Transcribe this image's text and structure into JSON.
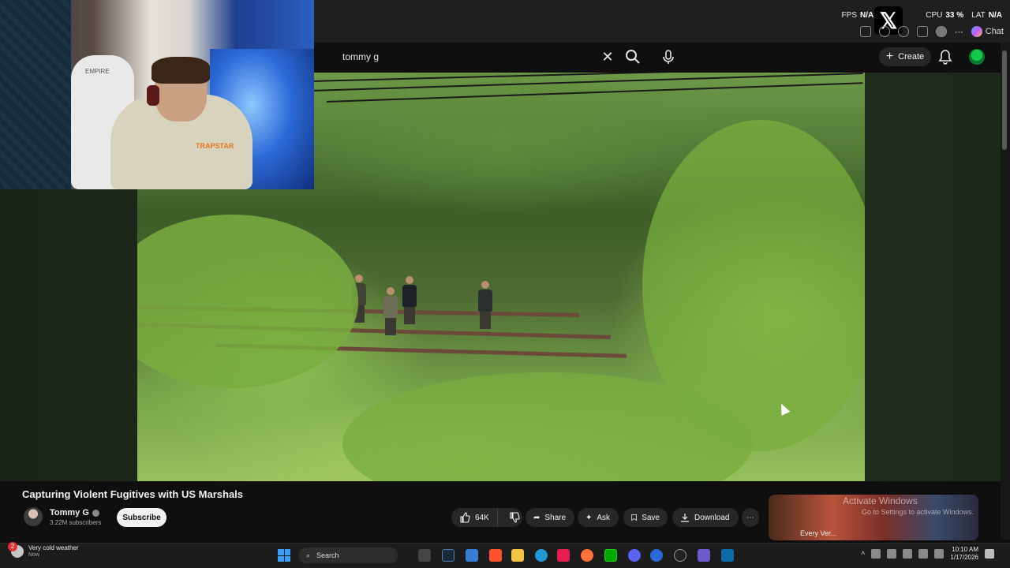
{
  "overlay": {
    "fps_label": "FPS",
    "fps_value": "N/A",
    "cpu_label": "CPU",
    "cpu_value": "33 %",
    "lat_label": "LAT",
    "lat_value": "N/A",
    "chat_label": "Chat"
  },
  "search": {
    "query": "tommy g"
  },
  "header": {
    "create_label": "Create"
  },
  "webcam": {
    "chair_text": "EMPIRE",
    "hoodie_logo": "TRAPSTAR"
  },
  "video": {
    "title": "Capturing Violent Fugitives with US Marshals",
    "channel": "Tommy G",
    "subscribers": "3.22M subscribers",
    "subscribe_label": "Subscribe",
    "likes": "64K",
    "share_label": "Share",
    "ask_label": "Ask",
    "save_label": "Save",
    "download_label": "Download"
  },
  "watermark": {
    "line1": "Activate Windows",
    "line2": "Go to Settings to activate Windows."
  },
  "suggestion": {
    "title": "Every Ver..."
  },
  "taskbar": {
    "weather_text": "Very cold weather",
    "weather_sub": "Now",
    "weather_badge": "2",
    "search_label": "Search",
    "time": "10:10 AM",
    "date": "1/17/2026"
  },
  "colors": {
    "accent": "#3ea6ff",
    "subscribe_bg": "#f1f1f1",
    "pill_bg": "#272727"
  }
}
